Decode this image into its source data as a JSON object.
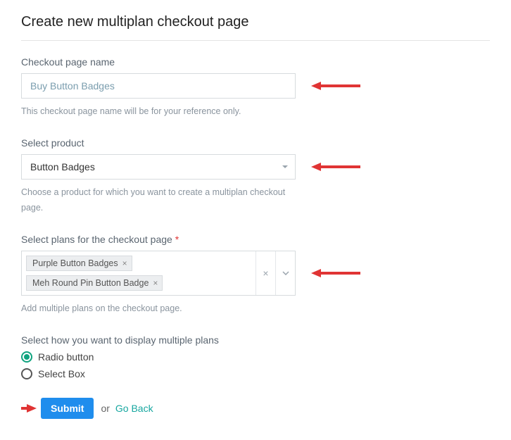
{
  "title": "Create new multiplan checkout page",
  "fields": {
    "name": {
      "label": "Checkout page name",
      "value": "Buy Button Badges",
      "helper": "This checkout page name will be for your reference only."
    },
    "product": {
      "label": "Select product",
      "value": "Button Badges",
      "helper": "Choose a product for which you want to create a multiplan checkout page."
    },
    "plans": {
      "label": "Select plans for the checkout page",
      "required_mark": "*",
      "tags": [
        "Purple Button Badges",
        "Meh Round Pin Button Badge"
      ],
      "helper": "Add multiple plans on the checkout page."
    },
    "display": {
      "label": "Select how you want to display multiple plans",
      "options": [
        "Radio button",
        "Select Box"
      ],
      "selected": "Radio button"
    }
  },
  "actions": {
    "submit": "Submit",
    "or": "or",
    "go_back": "Go Back"
  }
}
